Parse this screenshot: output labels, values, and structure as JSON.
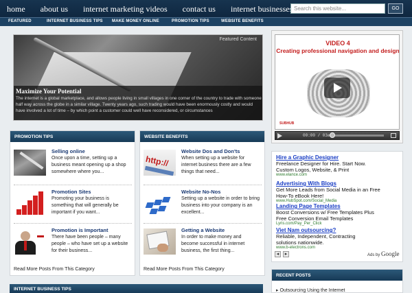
{
  "nav": {
    "items": [
      "home",
      "about us",
      "internet marketing videos",
      "contact us",
      "internet businesses store"
    ],
    "search_placeholder": "Search this website...",
    "search_button": "GO"
  },
  "categories": [
    "FEATURED",
    "INTERNET BUSINESS TIPS",
    "MAKE MONEY ONLINE",
    "PROMOTION TIPS",
    "WEBSITE BENEFITS"
  ],
  "featured": {
    "label": "Featured Content",
    "title": "Maximize Your Potential",
    "text": "The internet is a global marketplace, and allows people living in small villages in one corner of the country to trade with someone half way across the globe in a similar village. Twenty years ago, such trading would have been enormously costly and would have involved a lot of time – by which point a customer could well have reconsidered, or circumstances"
  },
  "video": {
    "title1": "VIDEO 4",
    "title2": "Creating professional navigation and design",
    "logo": "SUBHUB",
    "time": "00:00 / 03:5"
  },
  "promotion": {
    "heading": "PROMOTION TIPS",
    "posts": [
      {
        "title": "Selling online",
        "excerpt": "Once upon a time, setting up a business meant opening up a shop somewhere where you..."
      },
      {
        "title": "Promotion Sites",
        "excerpt": "Promoting your business is something that will generally be important if you want..."
      },
      {
        "title": "Promotion is Important",
        "excerpt": "There have been people – many people – who have set up a website for their business..."
      }
    ],
    "more": "Read More Posts From This Category"
  },
  "benefits": {
    "heading": "WEBSITE BENEFITS",
    "thumb_text": "http://",
    "posts": [
      {
        "title": "Website Dos and Don'ts",
        "excerpt": "When setting up a website for internet business there are a few things that need..."
      },
      {
        "title": "Website No-Nos",
        "excerpt": "Setting up a website in order to bring business into your company is an excellent..."
      },
      {
        "title": "Getting a Website",
        "excerpt": "In order to make money and become successful in internet business, the first thing..."
      }
    ],
    "more": "Read More Posts From This Category"
  },
  "ads": [
    {
      "title": "Hire a Graphic Designer",
      "line1": "Freelance Designer for Hire. Start Now.",
      "line2": "Custom Logos, Website, & Print",
      "url": "www.elance.com"
    },
    {
      "title": "Advertising With Blogs",
      "line1": "Get More Leads from Social Media in an Free",
      "line2": "How-To eBook Here!",
      "url": "www.HubSpot.com/Social_Media"
    },
    {
      "title": "Landing Page Templates",
      "line1": "Boost Conversions w/ Free Templates Plus",
      "line2": "Free Conversion Email Templates",
      "url": "Lyris.com/Pay_Per_Click"
    },
    {
      "title": "Viet Nam outsourcing?",
      "line1": "Reliable, Independent, Contracting",
      "line2": "solutions nationwide.",
      "url": "www.b-electrons.com"
    }
  ],
  "adsby": {
    "prefix": "Ads by",
    "brand": "Google"
  },
  "recent": {
    "heading": "RECENT POSTS",
    "items": [
      "Outsourcing Using the Internet"
    ]
  },
  "bottom_heading": "INTERNET BUSINESS TIPS"
}
